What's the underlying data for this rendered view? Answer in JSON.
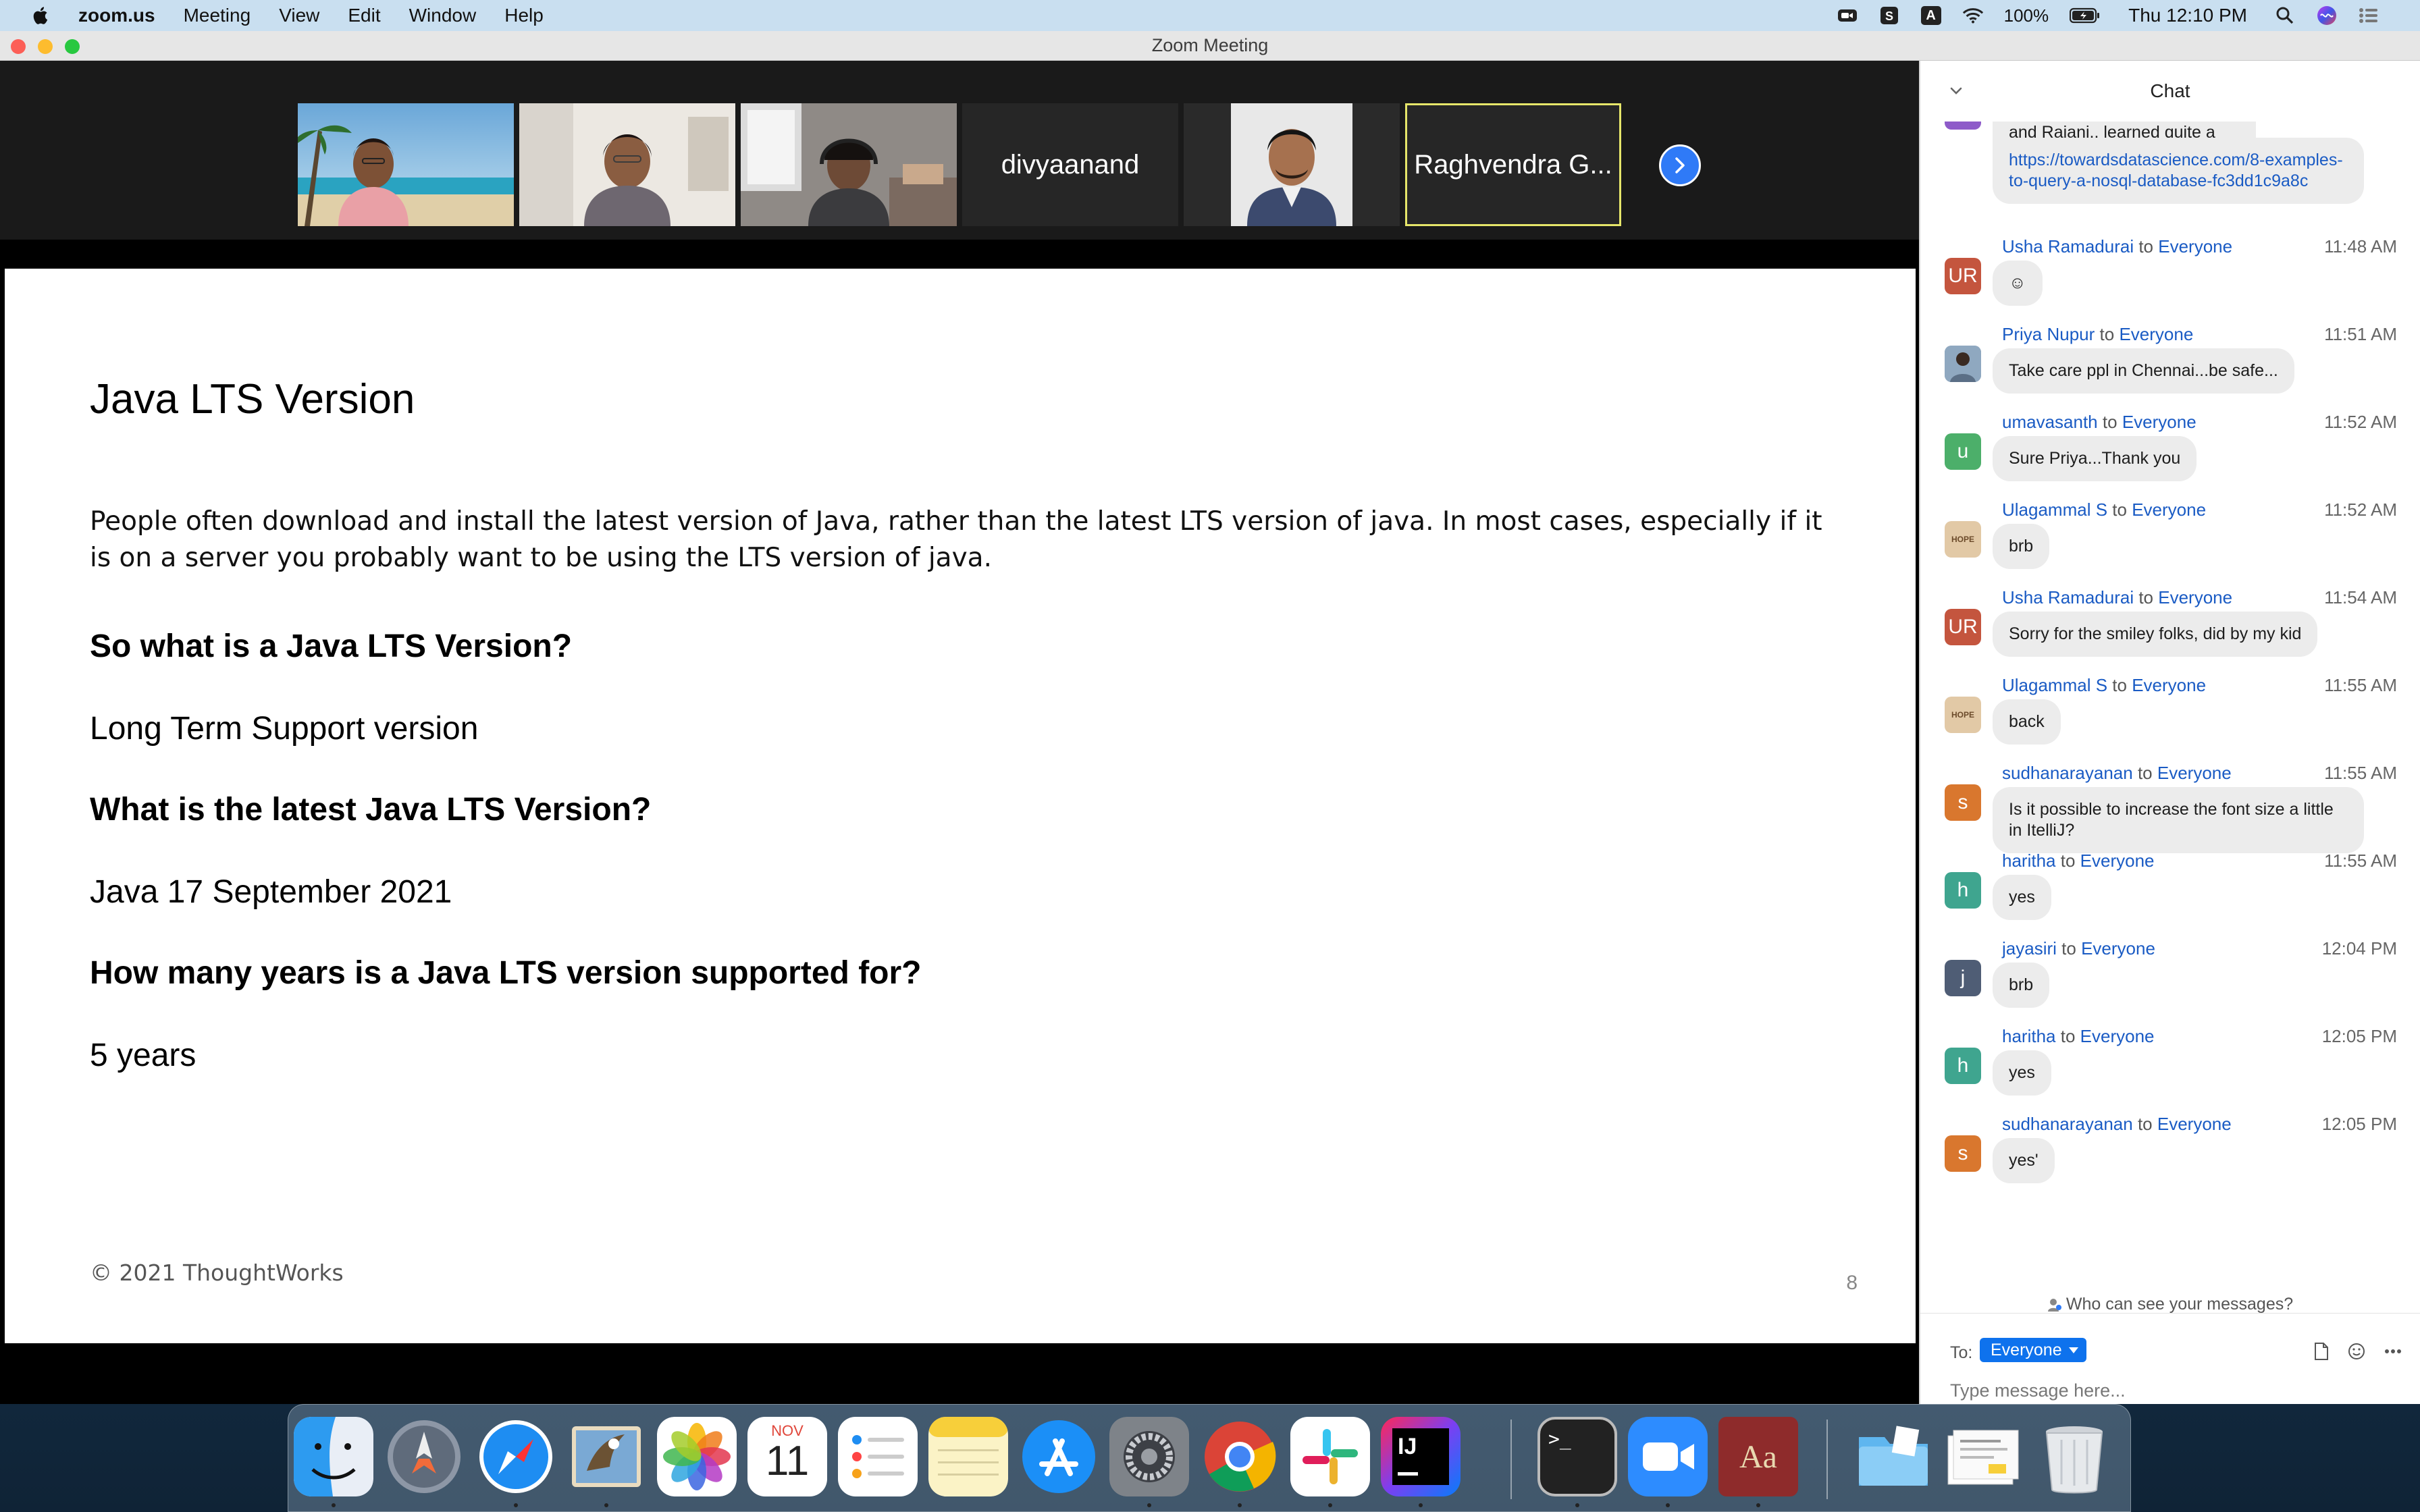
{
  "menubar": {
    "app_name": "zoom.us",
    "items": [
      "Meeting",
      "View",
      "Edit",
      "Window",
      "Help"
    ],
    "battery": "100%",
    "clock": "Thu 12:10 PM",
    "status_icons": [
      "zoom-menu-icon",
      "scribe-icon",
      "text-input-a-icon",
      "wifi-icon",
      "battery-icon",
      "spotlight-search-icon",
      "siri-icon",
      "notification-center-icon"
    ]
  },
  "window": {
    "title": "Zoom Meeting"
  },
  "participants": [
    {
      "name": "",
      "type": "video"
    },
    {
      "name": "",
      "type": "video"
    },
    {
      "name": "",
      "type": "video"
    },
    {
      "name": "divyaanand",
      "type": "name"
    },
    {
      "name": "",
      "type": "video"
    },
    {
      "name": "Raghvendra G...",
      "type": "name",
      "active": true
    }
  ],
  "slide": {
    "title": "Java LTS Version",
    "intro": "People often download and install the latest version of Java, rather than the latest LTS version of java. In most cases, especially if it is on a server you probably want to be using the LTS version of java.",
    "q1": "So what is a Java LTS Version?",
    "a1": "Long Term Support version",
    "q2": "What is the latest Java LTS Version?",
    "a2": "Java 17 September 2021",
    "q3": "How many years is a Java LTS version supported for?",
    "a3": "5 years",
    "footer": "© 2021 ThoughtWorks",
    "page_number": "8"
  },
  "chat": {
    "title": "Chat",
    "partial_top": "Many many thanks Anusha and Rajani.. learned quite a few new things",
    "link_message": "https://towardsdatascience.com/8-examples-to-query-a-nosql-database-fc3dd1c9a8c",
    "messages": [
      {
        "sender": "Usha Ramadurai",
        "to": "to",
        "recipient": "Everyone",
        "time": "11:48 AM",
        "text": "☺",
        "avatar": "UR",
        "color": "#c4553e"
      },
      {
        "sender": "Priya Nupur",
        "to": "to",
        "recipient": "Everyone",
        "time": "11:51 AM",
        "text": "Take care ppl in Chennai...be safe...",
        "avatar": "",
        "color": "#6d8aa6"
      },
      {
        "sender": "umavasanth",
        "to": "to",
        "recipient": "Everyone",
        "time": "11:52 AM",
        "text": "Sure Priya...Thank you",
        "avatar": "u",
        "color": "#4caf6a"
      },
      {
        "sender": "Ulagammal  S",
        "to": "to",
        "recipient": "Everyone",
        "time": "11:52 AM",
        "text": "brb",
        "avatar": "HOPE",
        "color": "#e2c9a6"
      },
      {
        "sender": "Usha Ramadurai",
        "to": "to",
        "recipient": "Everyone",
        "time": "11:54 AM",
        "text": "Sorry for the smiley folks, did by my kid",
        "avatar": "UR",
        "color": "#c4553e"
      },
      {
        "sender": "Ulagammal  S",
        "to": "to",
        "recipient": "Everyone",
        "time": "11:55 AM",
        "text": "back",
        "avatar": "HOPE",
        "color": "#e2c9a6"
      },
      {
        "sender": "sudhanarayanan",
        "to": "to",
        "recipient": "Everyone",
        "time": "11:55 AM",
        "text": "Is it possible to increase the font size a little in ItelliJ?",
        "avatar": "s",
        "color": "#d9772e"
      },
      {
        "sender": "haritha",
        "to": "to",
        "recipient": "Everyone",
        "time": "11:55 AM",
        "text": "yes",
        "avatar": "h",
        "color": "#3fa58f"
      },
      {
        "sender": "jayasiri",
        "to": "to",
        "recipient": "Everyone",
        "time": "12:04 PM",
        "text": "brb",
        "avatar": "j",
        "color": "#4f5d75"
      },
      {
        "sender": "haritha",
        "to": "to",
        "recipient": "Everyone",
        "time": "12:05 PM",
        "text": "yes",
        "avatar": "h",
        "color": "#3fa58f"
      },
      {
        "sender": "sudhanarayanan",
        "to": "to",
        "recipient": "Everyone",
        "time": "12:05 PM",
        "text": "yes'",
        "avatar": "s",
        "color": "#d9772e"
      }
    ],
    "who_can_see": "Who can see your messages?",
    "to_label": "To:",
    "to_value": "Everyone",
    "input_placeholder": "Type message here..."
  },
  "dock": {
    "apps": [
      "finder-icon",
      "launchpad-icon",
      "safari-icon",
      "mail-icon",
      "photos-icon",
      "calendar-icon",
      "reminders-icon",
      "notes-icon",
      "app-store-icon",
      "system-preferences-icon",
      "chrome-icon",
      "slack-icon",
      "intellij-icon",
      "terminal-icon",
      "zoom-icon",
      "dictionary-icon",
      "downloads-folder-icon",
      "document-stack-icon",
      "trash-icon"
    ],
    "calendar_month": "NOV",
    "calendar_day": "11",
    "intellij_label": "IJ",
    "dictionary_label": "Aa",
    "terminal_prompt": ">_"
  }
}
